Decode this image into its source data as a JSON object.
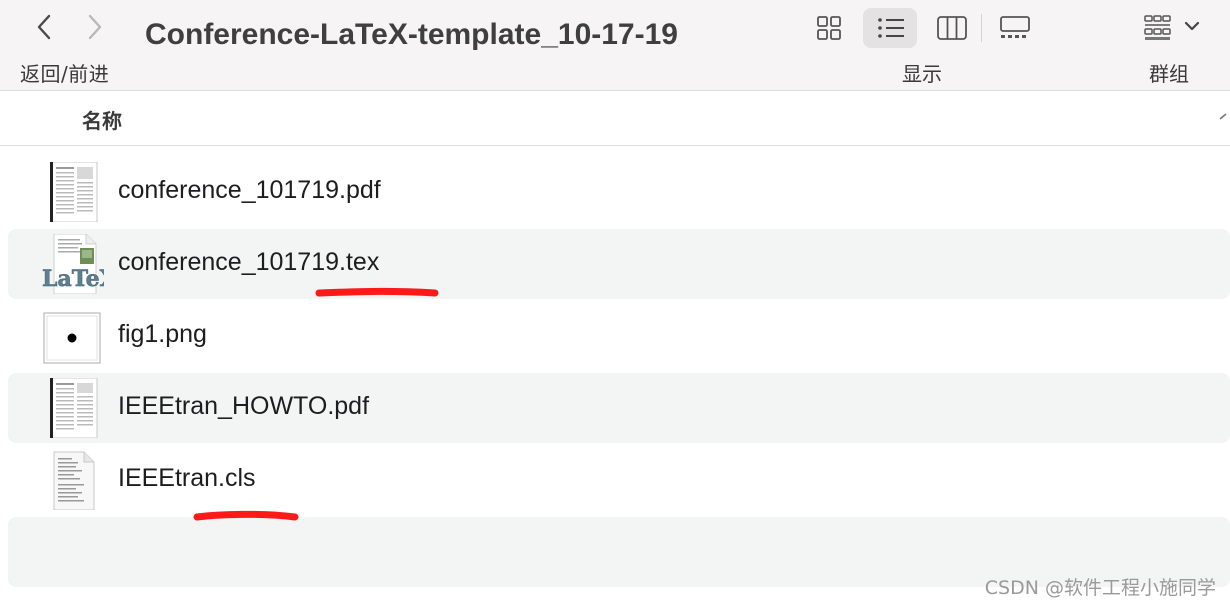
{
  "toolbar": {
    "back_label": "返回/前进",
    "title": "Conference-LaTeX-template_10-17-19",
    "display_label": "显示",
    "group_label": "群组",
    "active_view": "list"
  },
  "columns": {
    "name_header": "名称"
  },
  "files": [
    {
      "name": "conference_101719.pdf",
      "icon": "pdf-document-icon"
    },
    {
      "name": "conference_101719.tex",
      "icon": "latex-file-icon",
      "underlined": true
    },
    {
      "name": "fig1.png",
      "icon": "png-image-icon"
    },
    {
      "name": "IEEEtran_HOWTO.pdf",
      "icon": "pdf-document-icon"
    },
    {
      "name": "IEEEtran.cls",
      "icon": "text-document-icon",
      "underlined": true
    }
  ],
  "annotation_color": "#ff1a1a",
  "watermark": "CSDN @软件工程小施同学"
}
